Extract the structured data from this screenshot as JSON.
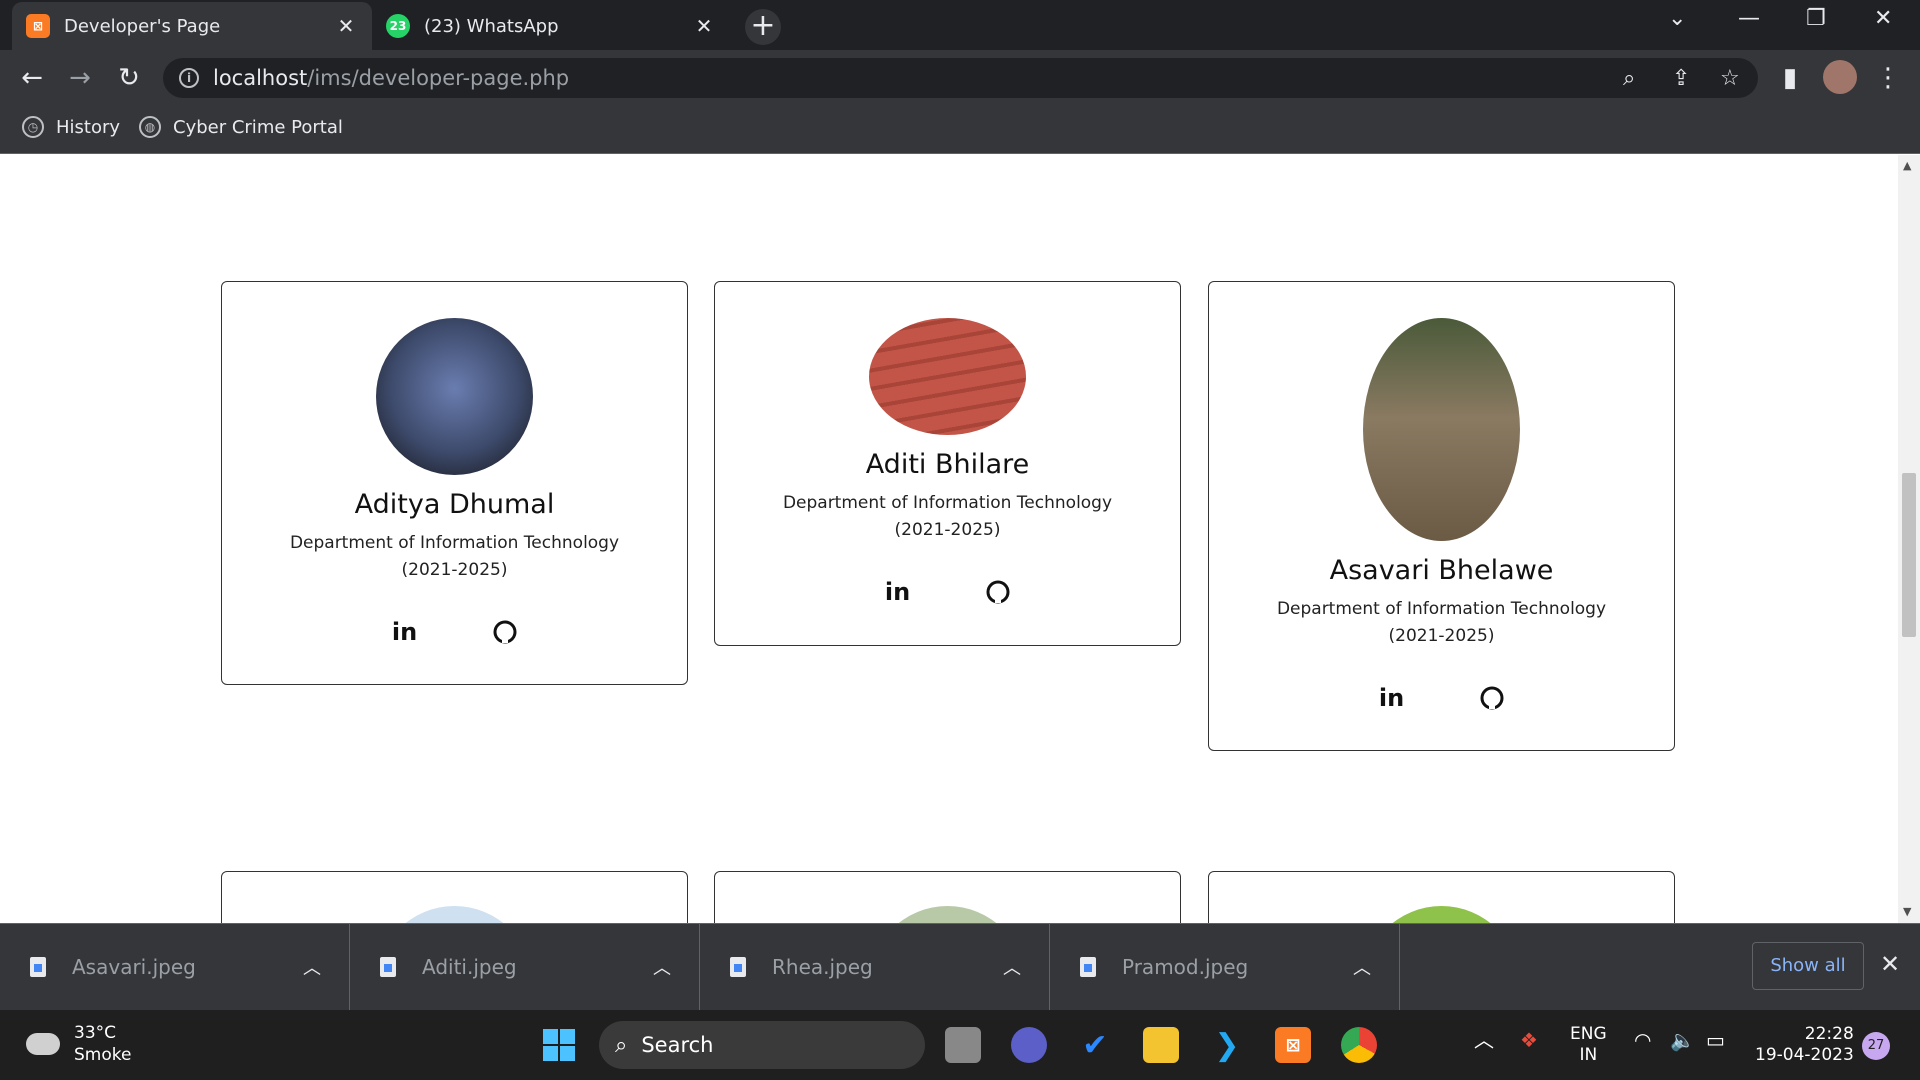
{
  "browser": {
    "tabs": [
      {
        "title": "Developer's Page",
        "favicon": "xampp-icon",
        "active": true
      },
      {
        "title": "(23) WhatsApp",
        "favicon": "whatsapp-icon",
        "badge": "23",
        "active": false
      }
    ],
    "address": {
      "host": "localhost",
      "path": "/ims/developer-page.php"
    },
    "bookmarks": [
      {
        "label": "History",
        "icon": "history-icon"
      },
      {
        "label": "Cyber Crime Portal",
        "icon": "globe-icon"
      }
    ]
  },
  "developers": [
    {
      "name": "Aditya Dhumal",
      "dept": "Department of Information Technology (2021-2025)",
      "photo_color": "#3d4a6b"
    },
    {
      "name": "Aditi Bhilare",
      "dept": "Department of Information Technology (2021-2025)",
      "photo_color": "#b84a3f"
    },
    {
      "name": "Asavari Bhelawe",
      "dept": "Department of Information Technology (2021-2025)",
      "photo_color": "#7d6b55"
    }
  ],
  "social": {
    "linkedin": "in",
    "github": "github-icon"
  },
  "downloads": {
    "files": [
      "Asavari.jpeg",
      "Aditi.jpeg",
      "Rhea.jpeg",
      "Pramod.jpeg"
    ],
    "show_all": "Show all"
  },
  "taskbar": {
    "weather": {
      "temp": "33°C",
      "condition": "Smoke"
    },
    "search": "Search",
    "lang": {
      "line1": "ENG",
      "line2": "IN"
    },
    "time": "22:28",
    "date": "19-04-2023",
    "notifications": "27"
  }
}
